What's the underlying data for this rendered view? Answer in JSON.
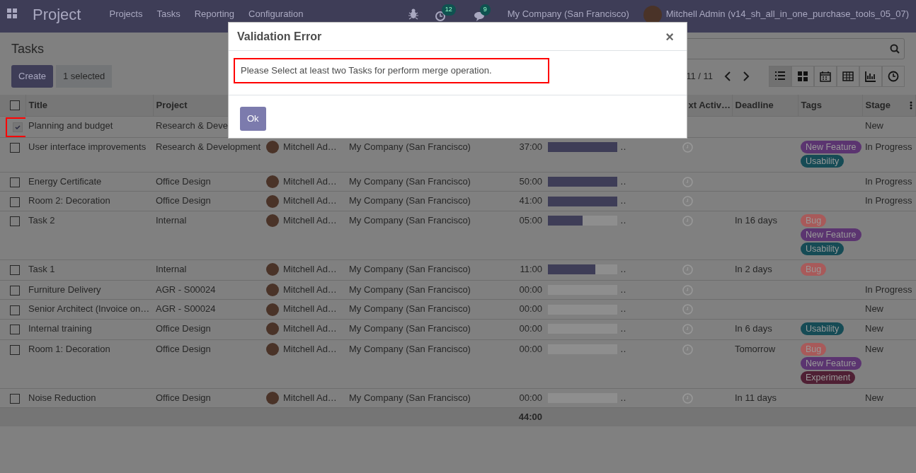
{
  "navbar": {
    "app": "Project",
    "menu": [
      "Projects",
      "Tasks",
      "Reporting",
      "Configuration"
    ],
    "notifications": [
      {
        "kind": "activity",
        "count": "12"
      },
      {
        "kind": "messages",
        "count": "9"
      }
    ],
    "company": "My Company (San Francisco)",
    "user": "Mitchell Admin (v14_sh_all_in_one_purchase_tools_05_07)"
  },
  "control_panel": {
    "title": "Tasks",
    "buttons": [
      {
        "label": "Create",
        "kind": "primary"
      },
      {
        "label": "1 selected",
        "kind": "secondary"
      }
    ],
    "pager": "11 / 11",
    "views": [
      {
        "kind": "list",
        "selected": true
      },
      {
        "kind": "kanban",
        "selected": false
      },
      {
        "kind": "calendar",
        "selected": false
      },
      {
        "kind": "pivot",
        "selected": false
      },
      {
        "kind": "graph",
        "selected": false
      },
      {
        "kind": "activity",
        "selected": false
      }
    ]
  },
  "table": {
    "header_checked": false,
    "columns": [
      {
        "kind": "title",
        "label": "Title"
      },
      {
        "kind": "project",
        "label": "Project"
      },
      {
        "kind": "user"
      },
      {
        "kind": "company"
      },
      {
        "kind": "hours"
      },
      {
        "kind": "progress"
      },
      {
        "kind": "activity",
        "label": "xt Activ…"
      },
      {
        "kind": "deadline",
        "label": "Deadline"
      },
      {
        "kind": "tags",
        "label": "Tags"
      },
      {
        "kind": "stage",
        "label": "Stage"
      }
    ],
    "rows": [
      {
        "selected": true,
        "title": "Planning and budget",
        "project": "Research & Deve",
        "stage": "New"
      },
      {
        "selected": false,
        "title": "User interface improvements",
        "project": "Research & Development",
        "user": "Mitchell Ad…",
        "company": "My Company (San Francisco)",
        "hours": "37:00",
        "level": 1,
        "more": "…",
        "tags": [
          {
            "label": "New Feature",
            "color": "#5b3470"
          },
          {
            "label": "Usability",
            "color": "#164b55"
          }
        ],
        "stage": "In Progress"
      },
      {
        "selected": false,
        "title": "Energy Certificate",
        "project": "Office Design",
        "user": "Mitchell Ad…",
        "company": "My Company (San Francisco)",
        "hours": "50:00",
        "level": 1,
        "more": "…",
        "stage": "In Progress"
      },
      {
        "selected": false,
        "title": "Room 2: Decoration",
        "project": "Office Design",
        "user": "Mitchell Ad…",
        "company": "My Company (San Francisco)",
        "hours": "41:00",
        "level": 1,
        "more": "…",
        "stage": "In Progress"
      },
      {
        "selected": false,
        "title": "Task 2",
        "project": "Internal",
        "user": "Mitchell Ad…",
        "company": "My Company (San Francisco)",
        "hours": "05:00",
        "level": 0.5,
        "more": "…",
        "deadline": "In 16 days",
        "tags": [
          {
            "label": "Bug",
            "color": "#a85a5a"
          },
          {
            "label": "New Feature",
            "color": "#5b3470"
          },
          {
            "label": "Usability",
            "color": "#164b55"
          }
        ]
      },
      {
        "selected": false,
        "title": "Task 1",
        "project": "Internal",
        "user": "Mitchell Ad…",
        "company": "My Company (San Francisco)",
        "hours": "11:00",
        "level": 0.68,
        "more": "…",
        "deadline": "In 2 days",
        "tags": [
          {
            "label": "Bug",
            "color": "#a85a5a"
          }
        ]
      },
      {
        "selected": false,
        "title": "Furniture Delivery",
        "project": "AGR - S00024",
        "user": "Mitchell Ad…",
        "company": "My Company (San Francisco)",
        "hours": "00:00",
        "level": 0,
        "more": "…",
        "stage": "In Progress"
      },
      {
        "selected": false,
        "title": "Senior Architect (Invoice on…",
        "project": "AGR - S00024",
        "user": "Mitchell Ad…",
        "company": "My Company (San Francisco)",
        "hours": "00:00",
        "level": 0,
        "more": "…",
        "stage": "New"
      },
      {
        "selected": false,
        "title": "Internal training",
        "project": "Office Design",
        "user": "Mitchell Ad…",
        "company": "My Company (San Francisco)",
        "hours": "00:00",
        "level": 0,
        "more": "…",
        "deadline": "In 6 days",
        "tags": [
          {
            "label": "Usability",
            "color": "#164b55"
          }
        ],
        "stage": "New"
      },
      {
        "selected": false,
        "title": "Room 1: Decoration",
        "project": "Office Design",
        "user": "Mitchell Ad…",
        "company": "My Company (San Francisco)",
        "hours": "00:00",
        "level": 0,
        "more": "…",
        "deadline": "Tomorrow",
        "tags": [
          {
            "label": "Bug",
            "color": "#a85a5a"
          },
          {
            "label": "New Feature",
            "color": "#5b3470"
          },
          {
            "label": "Experiment",
            "color": "#4f2034"
          }
        ],
        "stage": "New"
      },
      {
        "selected": false,
        "title": "Noise Reduction",
        "project": "Office Design",
        "user": "Mitchell Ad…",
        "company": "My Company (San Francisco)",
        "hours": "00:00",
        "level": 0,
        "more": "…",
        "deadline": "In 11 days",
        "stage": "New"
      }
    ],
    "total_hours": "44:00"
  },
  "dialog": {
    "title": "Validation Error",
    "close": "×",
    "message": "Please Select at least two Tasks for perform merge operation.",
    "button": "Ok"
  }
}
